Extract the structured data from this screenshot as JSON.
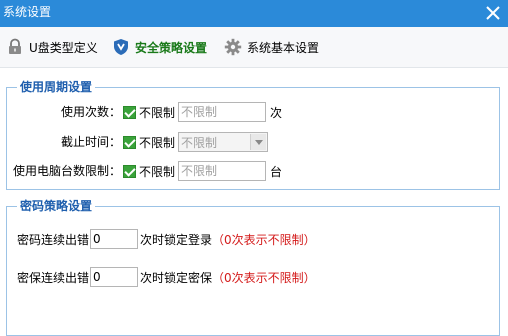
{
  "window": {
    "title": "系统设置"
  },
  "tabs": [
    {
      "label": "U盘类型定义",
      "icon": "lock-icon"
    },
    {
      "label": "安全策略设置",
      "icon": "shield-icon",
      "active": true
    },
    {
      "label": "系统基本设置",
      "icon": "gear-icon"
    }
  ],
  "usage": {
    "legend": "使用周期设置",
    "uses_label": "使用次数：",
    "uses_check": "不限制",
    "uses_placeholder": "不限制",
    "uses_unit": "次",
    "expire_label": "截止时间：",
    "expire_check": "不限制",
    "expire_selected": "不限制",
    "pc_label": "使用电脑台数限制：",
    "pc_check": "不限制",
    "pc_placeholder": "不限制",
    "pc_unit": "台"
  },
  "password": {
    "legend": "密码策略设置",
    "row1_label": "密码连续出错",
    "row1_value": "0",
    "row1_suffix": "次时锁定登录",
    "row1_note": "（0次表示不限制）",
    "row2_label": "密保连续出错",
    "row2_value": "0",
    "row2_suffix": "次时锁定密保",
    "row2_note": "（0次表示不限制）"
  },
  "colors": {
    "titlebar": "#2b8ad9",
    "active_tab": "#1a7a1a",
    "legend": "#1f5fae",
    "note": "#d41a1a",
    "check": "#3aa33a"
  }
}
